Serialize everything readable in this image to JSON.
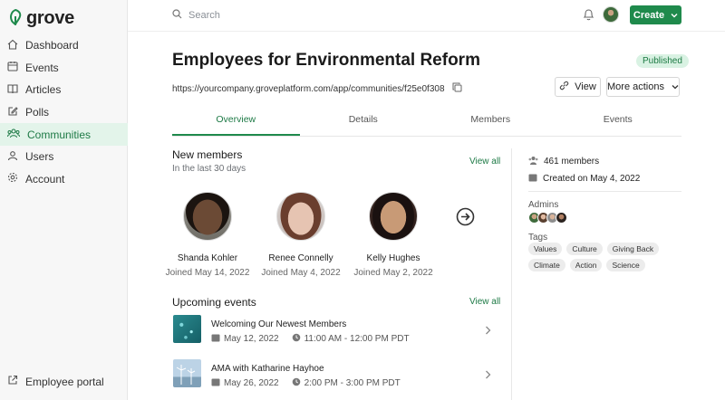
{
  "brand": {
    "name": "grove",
    "accent": "#1f8a4c"
  },
  "sidebar": {
    "items": [
      {
        "label": "Dashboard",
        "icon": "home-icon",
        "active": false
      },
      {
        "label": "Events",
        "icon": "calendar-icon",
        "active": false
      },
      {
        "label": "Articles",
        "icon": "book-icon",
        "active": false
      },
      {
        "label": "Polls",
        "icon": "edit-icon",
        "active": false
      },
      {
        "label": "Communities",
        "icon": "people-icon",
        "active": true
      },
      {
        "label": "Users",
        "icon": "user-icon",
        "active": false
      },
      {
        "label": "Account",
        "icon": "gear-icon",
        "active": false
      }
    ],
    "footer_label": "Employee portal"
  },
  "topbar": {
    "search_placeholder": "Search",
    "create_label": "Create"
  },
  "page": {
    "title": "Employees for Environmental Reform",
    "status": "Published",
    "url": "https://yourcompany.groveplatform.com/app/communities/f25e0f308",
    "view_label": "View",
    "more_actions_label": "More actions"
  },
  "tabs": [
    {
      "label": "Overview",
      "active": true
    },
    {
      "label": "Details",
      "active": false
    },
    {
      "label": "Members",
      "active": false
    },
    {
      "label": "Events",
      "active": false
    }
  ],
  "new_members": {
    "title": "New members",
    "subtitle": "In the last 30 days",
    "view_all": "View all",
    "members": [
      {
        "name": "Shanda Kohler",
        "joined": "Joined May 14, 2022"
      },
      {
        "name": "Renee Connelly",
        "joined": "Joined May 4, 2022"
      },
      {
        "name": "Kelly Hughes",
        "joined": "Joined May 2, 2022"
      }
    ]
  },
  "upcoming_events": {
    "title": "Upcoming events",
    "view_all": "View all",
    "events": [
      {
        "title": "Welcoming Our Newest Members",
        "date": "May 12, 2022",
        "time": "11:00 AM - 12:00 PM PDT"
      },
      {
        "title": "AMA with Katharine Hayhoe",
        "date": "May 26, 2022",
        "time": "2:00 PM - 3:00 PM PDT"
      }
    ]
  },
  "side_panel": {
    "members_count": "461 members",
    "created": "Created on May 4, 2022",
    "admins_label": "Admins",
    "tags_label": "Tags",
    "tags": [
      "Values",
      "Culture",
      "Giving Back",
      "Climate",
      "Action",
      "Science"
    ]
  }
}
